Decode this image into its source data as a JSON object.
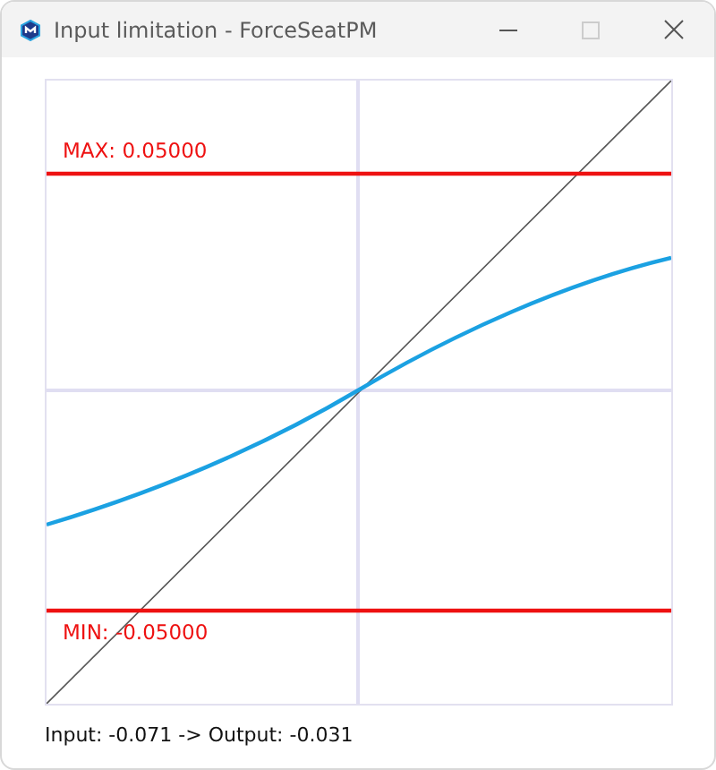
{
  "window": {
    "title": "Input limitation - ForceSeatPM"
  },
  "plot": {
    "max_label": "MAX: 0.05000",
    "min_label": "MIN: -0.05000"
  },
  "status": "Input: -0.071 -> Output: -0.031"
}
